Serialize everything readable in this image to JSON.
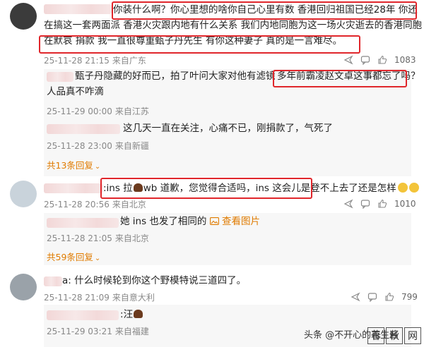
{
  "comments": [
    {
      "text_line1": "你装什么啊？你心里想的啥你自己心里有数  香港回归祖国已经28年  你还",
      "text_line2": "在搞这一套两面派   香港火灾跟内地有什么关系     我们内地同胞为这一场火灾逝去的香港同胞 都",
      "text_line3": "在默哀  捐款   我一直很尊重甄子丹先生   有你这种妻子  真的是一言难尽。",
      "time": "25-11-28 21:15",
      "location": "来自广东",
      "likes": "1083"
    },
    {
      "text_line1a": "甄子丹隐藏的好而已，拍了叶问大家对他有滤镜",
      "text_line1b": "多年前霸凌赵文卓这事都忘了吗？",
      "text_line2": "人品真不咋滴",
      "time": "25-11-29 00:00",
      "location": "来自江苏"
    },
    {
      "text": "这几天一直在关注，心痛不已，刚捐款了，气死了",
      "time": "25-11-28 23:00",
      "location": "来自新疆"
    },
    {
      "expand_label": "共13条回复"
    },
    {
      "text_a": ":ins 拉",
      "text_b": "wb 道歉，您觉得合适吗，ins 这会儿是登不上去了还是怎样",
      "time": "25-11-28 20:56",
      "location": "来自北京",
      "likes": "1010"
    },
    {
      "text": "她 ins 也发了相同的",
      "img_link": "查看图片",
      "time": "25-11-28 21:05",
      "location": "来自北京"
    },
    {
      "expand_label": "共59条回复"
    },
    {
      "text": "a: 什么时候轮到你这个野模特说三道四了。",
      "time": "25-11-28 21:09",
      "location": "来自意大利",
      "likes": "799"
    },
    {
      "text": "汪",
      "time": "25-11-29 03:21",
      "location": "来自福建"
    }
  ],
  "icons": {
    "share": "share-icon",
    "comment": "comment-icon",
    "like": "thumbs-up-icon"
  },
  "watermark": {
    "text": "头条 @不开心的花生酱",
    "logo_a": "春",
    "logo_b": "秋",
    "logo_c": "网"
  },
  "colors": {
    "highlight_box": "#e0262b",
    "expand_link": "#e07b00",
    "meta_text": "#888888"
  }
}
